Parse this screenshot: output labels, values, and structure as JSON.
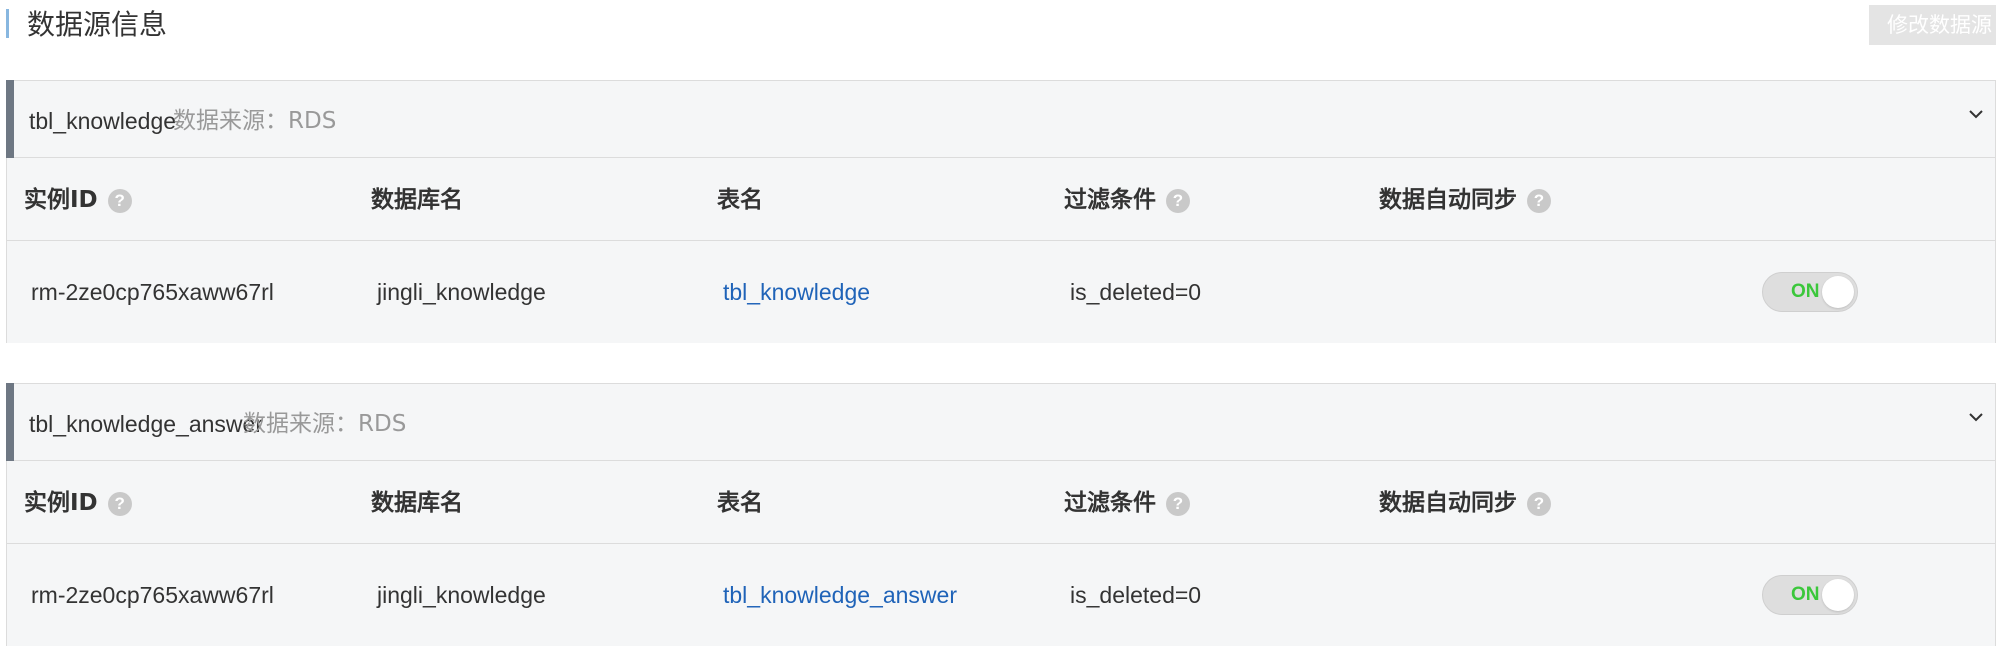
{
  "header": {
    "title": "数据源信息",
    "edit_button": "修改数据源"
  },
  "columns": [
    "实例ID",
    "数据库名",
    "表名",
    "过滤条件",
    "数据自动同步"
  ],
  "help_glyph": "?",
  "panels": [
    {
      "table_name": "tbl_knowledge",
      "source": "数据来源：RDS",
      "row": {
        "instance_id": "rm-2ze0cp765xaww67rl",
        "database": "jingli_knowledge",
        "table": "tbl_knowledge",
        "filter": "is_deleted=0",
        "sync": "ON"
      }
    },
    {
      "table_name": "tbl_knowledge_answer",
      "source": "数据来源：RDS",
      "row": {
        "instance_id": "rm-2ze0cp765xaww67rl",
        "database": "jingli_knowledge",
        "table": "tbl_knowledge_answer",
        "filter": "is_deleted=0",
        "sync": "ON"
      }
    }
  ],
  "colors": {
    "accent_bar": "#88b7e0",
    "panel_accent": "#6e7783",
    "link": "#1f63b8",
    "toggle_on_text": "#3bc73b",
    "panel_bg": "#f5f6f7"
  },
  "icons": {
    "help": "question-circle-icon",
    "collapse": "chevron-down-icon"
  }
}
